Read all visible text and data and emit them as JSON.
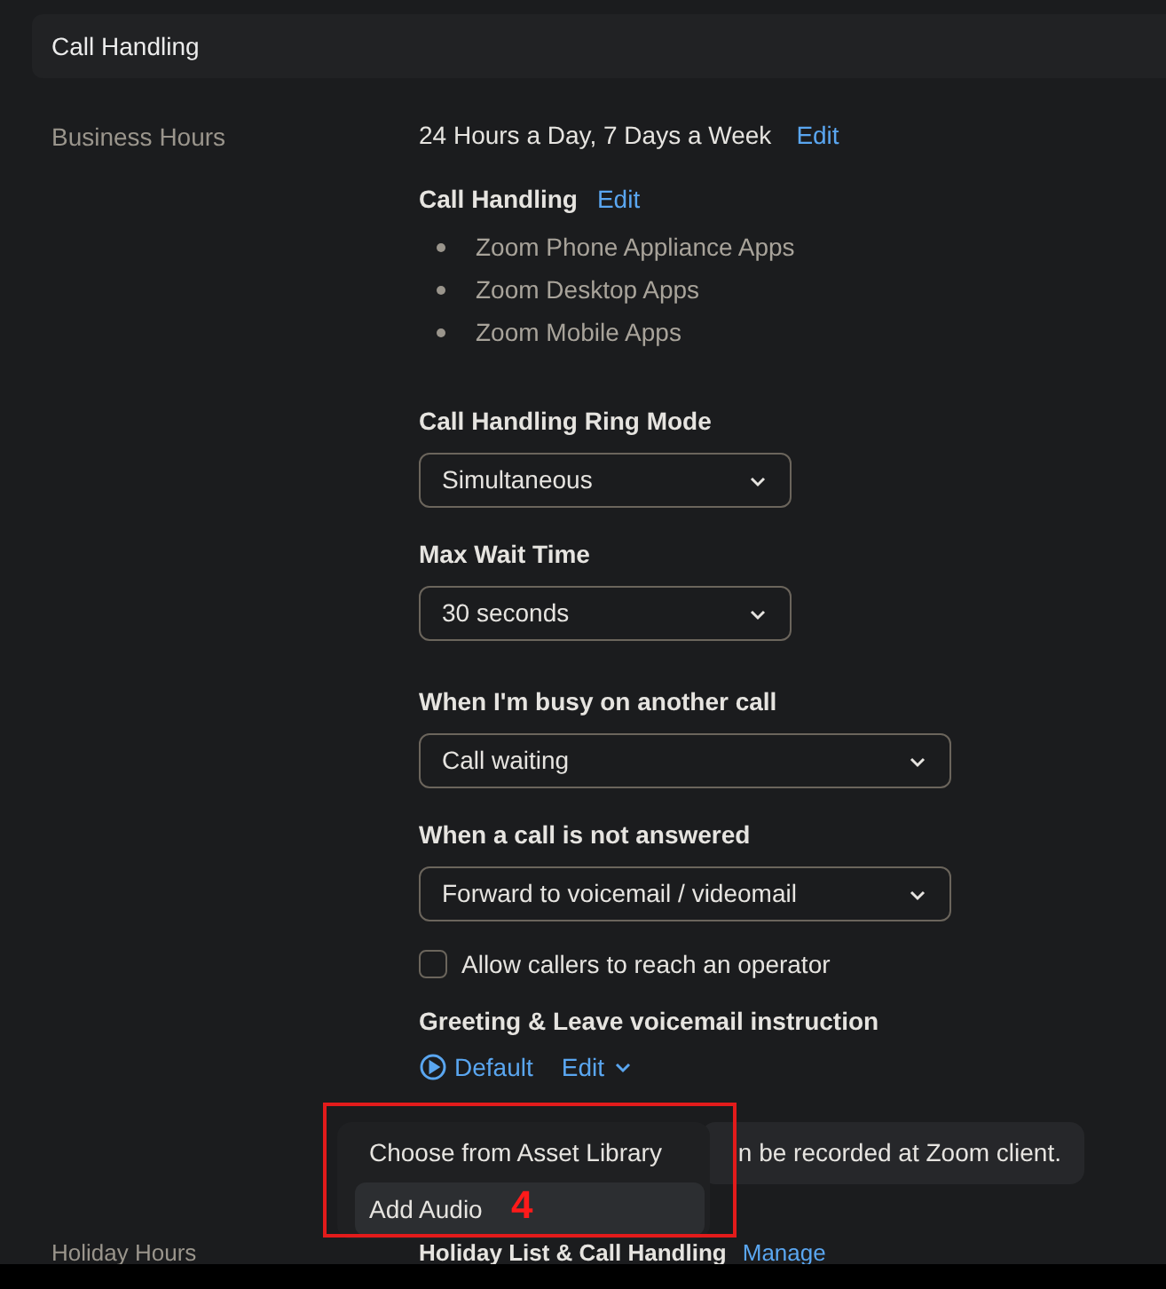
{
  "section": {
    "title": "Call Handling"
  },
  "business_hours": {
    "label": "Business Hours",
    "schedule": "24 Hours a Day, 7 Days a Week",
    "edit": "Edit"
  },
  "call_handling": {
    "title": "Call Handling",
    "edit": "Edit",
    "apps": [
      "Zoom Phone Appliance Apps",
      "Zoom Desktop Apps",
      "Zoom Mobile Apps"
    ]
  },
  "settings": [
    {
      "label": "Call Handling Ring Mode",
      "value": "Simultaneous",
      "wide": false
    },
    {
      "label": "Max Wait Time",
      "value": "30 seconds",
      "wide": false
    },
    {
      "label": "When I'm busy on another call",
      "value": "Call waiting",
      "wide": true
    },
    {
      "label": "When a call is not answered",
      "value": "Forward to voicemail / videomail",
      "wide": true
    }
  ],
  "operator": {
    "label": "Allow callers to reach an operator",
    "checked": false
  },
  "greeting": {
    "title": "Greeting & Leave voicemail instruction",
    "audio": "Default",
    "edit": "Edit"
  },
  "tooltip": {
    "text": "n be recorded at Zoom client."
  },
  "menu": {
    "items": [
      {
        "label": "Choose from Asset Library",
        "selected": false
      },
      {
        "label": "Add Audio",
        "selected": true
      }
    ]
  },
  "annotation": {
    "label": "4"
  },
  "holiday_hours": {
    "label": "Holiday Hours",
    "title": "Holiday List & Call Handling",
    "manage": "Manage"
  }
}
